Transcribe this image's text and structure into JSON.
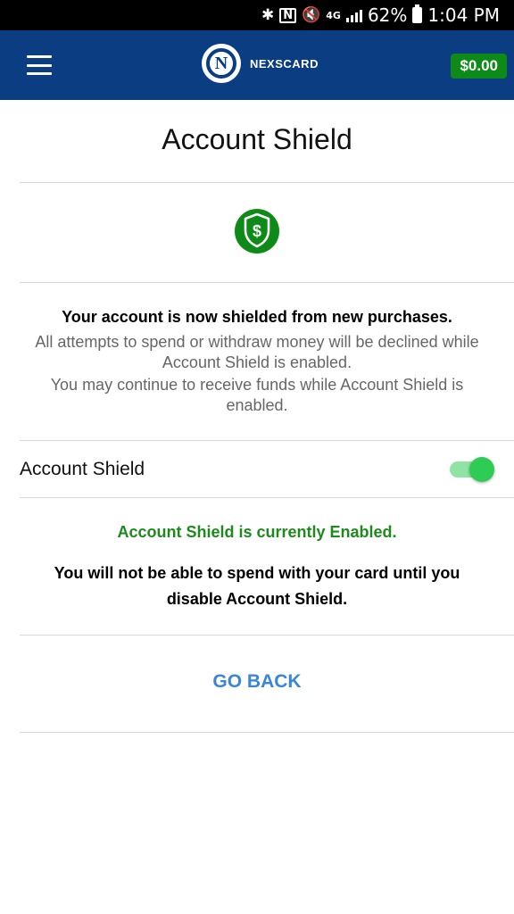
{
  "status_bar": {
    "network": "4G",
    "battery": "62%",
    "time": "1:04 PM"
  },
  "app_bar": {
    "logo_letter": "N",
    "brand": "NEXSCARD",
    "balance": "$0.00"
  },
  "page": {
    "title": "Account Shield",
    "shield_symbol": "$",
    "headline": "Your account is now shielded from new purchases.",
    "info_line1": "All attempts to spend or withdraw money will be declined while Account Shield is enabled.",
    "info_line2": "You may continue to receive funds while Account Shield is enabled.",
    "toggle_label": "Account Shield",
    "toggle_on": true,
    "status_text": "Account Shield is currently Enabled.",
    "warning_text": "You will not be able to spend with your card until you disable Account Shield.",
    "go_back_label": "GO BACK"
  },
  "colors": {
    "app_bar": "#0a3d82",
    "balance_badge": "#0d8a17",
    "shield": "#0d8a17",
    "status_enabled": "#1e8a1e",
    "link": "#3a86d4",
    "toggle_thumb": "#2ecc55"
  },
  "icons": [
    "bluetooth-icon",
    "nfc-icon",
    "mute-icon",
    "signal-icon",
    "battery-icon",
    "menu-icon",
    "shield-dollar-icon"
  ]
}
